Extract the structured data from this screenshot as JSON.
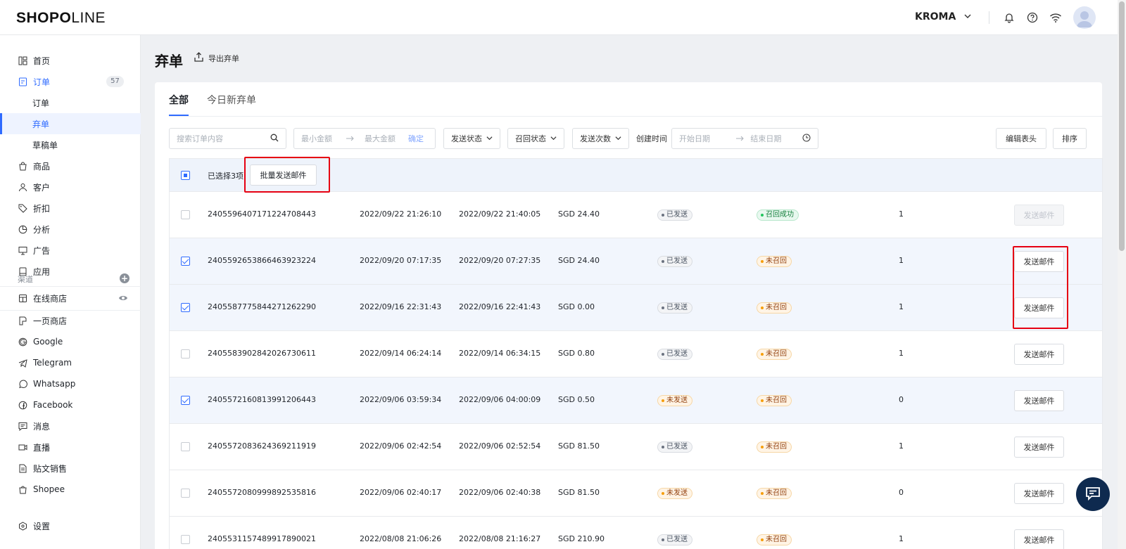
{
  "brand": {
    "logo_bold": "SHOP",
    "logo_o": "O",
    "logo_thin": "LINE"
  },
  "header": {
    "store_name": "KROMA"
  },
  "sidebar": {
    "items": [
      {
        "label": "首页"
      },
      {
        "label": "订单",
        "badge": "57"
      },
      {
        "label": "订单"
      },
      {
        "label": "弃单"
      },
      {
        "label": "草稿单"
      },
      {
        "label": "商品"
      },
      {
        "label": "客户"
      },
      {
        "label": "折扣"
      },
      {
        "label": "分析"
      },
      {
        "label": "广告"
      },
      {
        "label": "应用"
      }
    ],
    "channel_label": "渠道",
    "channels": [
      {
        "label": "在线商店"
      },
      {
        "label": "一页商店"
      },
      {
        "label": "Google"
      },
      {
        "label": "Telegram"
      },
      {
        "label": "Whatsapp"
      },
      {
        "label": "Facebook"
      },
      {
        "label": "消息"
      },
      {
        "label": "直播"
      },
      {
        "label": "贴文销售"
      },
      {
        "label": "Shopee"
      }
    ],
    "settings_label": "设置"
  },
  "page": {
    "title": "弃单",
    "export_label": "导出弃单"
  },
  "tabs": [
    {
      "label": "全部"
    },
    {
      "label": "今日新弃单"
    }
  ],
  "filters": {
    "search_placeholder": "搜索订单内容",
    "min_amount": "最小金额",
    "max_amount": "最大金额",
    "confirm": "确定",
    "send_status": "发送状态",
    "recall_status": "召回状态",
    "send_count": "发送次数",
    "created_time": "创建时间",
    "start_date": "开始日期",
    "end_date": "结束日期",
    "edit_header": "编辑表头",
    "sort": "排序"
  },
  "selection": {
    "text": "已选择3项",
    "bulk_button": "批量发送邮件"
  },
  "rows": [
    {
      "id": "2405596407171224708443",
      "created": "2022/09/22 21:26:10",
      "updated": "2022/09/22 21:40:05",
      "amount": "SGD 24.40",
      "send_status": "已发送",
      "recall_status": "召回成功",
      "count": "1",
      "action": "发送邮件",
      "checked": false
    },
    {
      "id": "2405592653866463923224",
      "created": "2022/09/20 07:17:35",
      "updated": "2022/09/20 07:27:35",
      "amount": "SGD 24.40",
      "send_status": "已发送",
      "recall_status": "未召回",
      "count": "1",
      "action": "发送邮件",
      "checked": true
    },
    {
      "id": "2405587775844271262290",
      "created": "2022/09/16 22:31:43",
      "updated": "2022/09/16 22:41:43",
      "amount": "SGD 0.00",
      "send_status": "已发送",
      "recall_status": "未召回",
      "count": "1",
      "action": "发送邮件",
      "checked": true
    },
    {
      "id": "2405583902842026730611",
      "created": "2022/09/14 06:24:14",
      "updated": "2022/09/14 06:34:15",
      "amount": "SGD 0.80",
      "send_status": "已发送",
      "recall_status": "未召回",
      "count": "1",
      "action": "发送邮件",
      "checked": false
    },
    {
      "id": "2405572160813991206443",
      "created": "2022/09/06 03:59:34",
      "updated": "2022/09/06 04:00:09",
      "amount": "SGD 0.50",
      "send_status": "未发送",
      "recall_status": "未召回",
      "count": "0",
      "action": "发送邮件",
      "checked": true
    },
    {
      "id": "2405572083624369211919",
      "created": "2022/09/06 02:42:54",
      "updated": "2022/09/06 02:52:54",
      "amount": "SGD 81.50",
      "send_status": "已发送",
      "recall_status": "未召回",
      "count": "1",
      "action": "发送邮件",
      "checked": false
    },
    {
      "id": "2405572080999892535816",
      "created": "2022/09/06 02:40:17",
      "updated": "2022/09/06 02:40:38",
      "amount": "SGD 81.50",
      "send_status": "未发送",
      "recall_status": "未召回",
      "count": "0",
      "action": "发送邮件",
      "checked": false
    },
    {
      "id": "2405531157489917890021",
      "created": "2022/08/08 21:06:26",
      "updated": "2022/08/08 21:16:27",
      "amount": "SGD 210.90",
      "send_status": "已发送",
      "recall_status": "未召回",
      "count": "1",
      "action": "发送邮件",
      "checked": false
    }
  ],
  "colors": {
    "accent": "#2f6bff",
    "highlight_box": "#e60012",
    "fab": "#0e2a4f"
  }
}
